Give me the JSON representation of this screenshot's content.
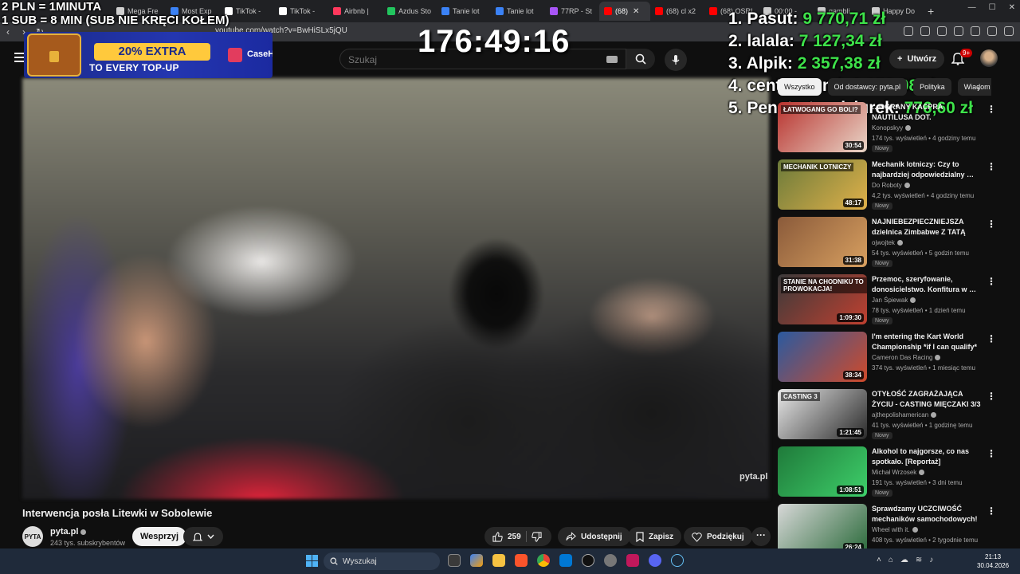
{
  "browser": {
    "tabs": [
      {
        "label": "Mega Fre",
        "color": "#d0d0d0"
      },
      {
        "label": "Most Exp",
        "color": "#3b82f6"
      },
      {
        "label": "TikTok - ",
        "color": "#ffffff"
      },
      {
        "label": "TikTok - ",
        "color": "#ffffff"
      },
      {
        "label": "Airbnb | ",
        "color": "#ff385c"
      },
      {
        "label": "Azdus Sto",
        "color": "#22c55e"
      },
      {
        "label": "Tanie lot",
        "color": "#3b82f6"
      },
      {
        "label": "Tanie lot",
        "color": "#3b82f6"
      },
      {
        "label": "77RP - St",
        "color": "#a855f7"
      },
      {
        "label": "(68) ",
        "color": "#ff0000",
        "active": true
      },
      {
        "label": "(68) cl x2",
        "color": "#ff0000"
      },
      {
        "label": "(68) OSRI",
        "color": "#ff0000"
      },
      {
        "label": "00:00 - ",
        "color": "#cccccc"
      },
      {
        "label": "gambli",
        "color": "#cccccc"
      },
      {
        "label": "Happy Do",
        "color": "#cccccc"
      }
    ],
    "url": "youtube.com/watch?v=BwHiSLx5jQU"
  },
  "header": {
    "search_placeholder": "Szukaj",
    "create_label": "Utwórz",
    "notif_count": "9+"
  },
  "ad": {
    "pill": "20% EXTRA",
    "subtitle": "TO EVERY TOP-UP",
    "brand": "CaseHug"
  },
  "overlay": {
    "line1": "2 PLN =  1MINUTA",
    "line2": "1 SUB = 8 MIN (SUB NIE KRĘCI KOŁEM)",
    "timer": "176:49:16",
    "leaderboard": [
      {
        "rank": "1.",
        "name": "Pasut:",
        "amount": "9 770,71 zł"
      },
      {
        "rank": "2.",
        "name": "lalala:",
        "amount": "7 127,34 zł"
      },
      {
        "rank": "3.",
        "name": "Alpik:",
        "amount": "2 357,38 zł"
      },
      {
        "rank": "4.",
        "name": "centurylond:",
        "amount": "2 173,08 zł"
      },
      {
        "rank": "5.",
        "name": "Penetrator dziurek:",
        "amount": "776,60 zł"
      }
    ]
  },
  "video": {
    "title": "Interwencja posła Litewki w Sobolewie",
    "watermark": "pyta.pl",
    "channel": {
      "avatar_text": "PYTA",
      "name": "pyta.pl",
      "subs": "243 tys. subskrybentów"
    },
    "support_label": "Wesprzyj",
    "likes": "259",
    "share_label": "Udostępnij",
    "save_label": "Zapisz",
    "thanks_label": "Podziękuj"
  },
  "sidebar": {
    "chips": [
      {
        "label": "Wszystko",
        "active": true
      },
      {
        "label": "Od dostawcy: pyta.pl",
        "active": false
      },
      {
        "label": "Polityka",
        "active": false
      },
      {
        "label": "Wiadom",
        "active": false
      }
    ],
    "recs": [
      {
        "title": "…OGRANY KACPRA NAUTILUSA DOT. ŁATWOGANGA (GARGAMEL, …",
        "channel": "Konopskyy",
        "meta": "174 tys. wyświetleń • 4 godziny temu",
        "duration": "30:54",
        "thumb_text": "ŁATWOGANG GO BOLI?",
        "new": "Nowy",
        "c1": "#b8322e",
        "c2": "#e9d6c8"
      },
      {
        "title": "Mechanik lotniczy: Czy to najbardziej odpowiedzialny …",
        "channel": "Do Roboty",
        "meta": "4,2 tys. wyświetleń • 4 godziny temu",
        "duration": "48:17",
        "thumb_text": "MECHANIK LOTNICZY",
        "new": "Nowy",
        "c1": "#6b7a3a",
        "c2": "#e0b14a"
      },
      {
        "title": "NAJNIEBEZPIECZNIEJSZA dzielnica Zimbabwe Z TATĄ",
        "channel": "ojwojtek",
        "meta": "54 tys. wyświetleń • 5 godzin temu",
        "duration": "31:38",
        "thumb_text": "",
        "new": "Nowy",
        "c1": "#8a5a3a",
        "c2": "#d8a060"
      },
      {
        "title": "Przemoc, szeryfowanie, donosicielstwo. Konfitura w …",
        "channel": "Jan Śpiewak",
        "meta": "78 tys. wyświetleń • 1 dzień temu",
        "duration": "1:09:30",
        "thumb_text": "STANIE NA CHODNIKU TO PROWOKACJA!",
        "new": "Nowy",
        "c1": "#3a3a3a",
        "c2": "#c04030"
      },
      {
        "title": "I'm entering the Kart World Championship *if I can qualify*",
        "channel": "Cameron Das Racing",
        "meta": "374 tys. wyświetleń • 1 miesiąc temu",
        "duration": "38:34",
        "thumb_text": "",
        "new": "",
        "c1": "#2a5aa0",
        "c2": "#d04a2a"
      },
      {
        "title": "OTYŁOŚĆ ZAGRAŻAJĄCA ŻYCIU - CASTING MIĘCZAKI 3/3",
        "channel": "ajthepolishamerican",
        "meta": "41 tys. wyświetleń • 1 godzinę temu",
        "duration": "1:21:45",
        "thumb_text": "CASTING 3",
        "new": "Nowy",
        "c1": "#e8e8e8",
        "c2": "#2a2a2a"
      },
      {
        "title": "Alkohol to najgorsze, co nas spotkało. [Reportaż]",
        "channel": "Michał Wrzosek",
        "meta": "191 tys. wyświetleń • 3 dni temu",
        "duration": "1:08:51",
        "thumb_text": "",
        "new": "Nowy",
        "c1": "#1f7a3a",
        "c2": "#3ecf6a"
      },
      {
        "title": "Sprawdzamy UCZCIWOŚĆ mechaników samochodowych!",
        "channel": "Wheel with it.",
        "meta": "408 tys. wyświetleń • 2 tygodnie temu",
        "duration": "26:24",
        "thumb_text": "",
        "new": "",
        "c1": "#d8d8d8",
        "c2": "#2a6a3a"
      }
    ]
  },
  "taskbar": {
    "search_label": "Wyszukaj",
    "time": "21:13",
    "date": "30.04.2026"
  }
}
